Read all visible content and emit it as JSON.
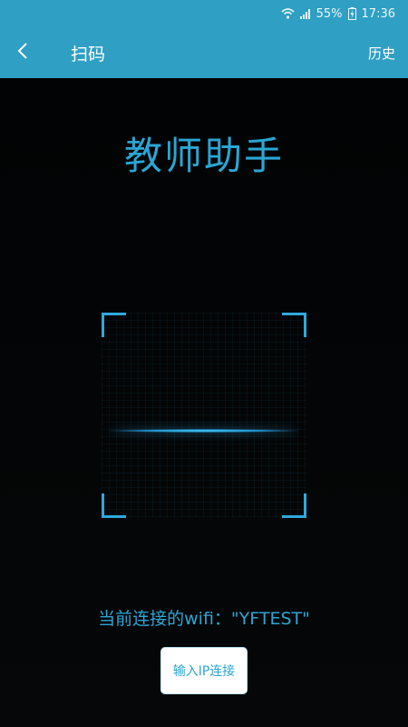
{
  "status_bar": {
    "battery": "55%",
    "time": "17:36",
    "icons": [
      "wifi-icon",
      "signal-icon",
      "battery-charging-icon"
    ]
  },
  "app_bar": {
    "back_icon": "chevron-left-icon",
    "title": "扫码",
    "history_label": "历史"
  },
  "main": {
    "app_name": "教师助手",
    "wifi_text": "当前连接的wifi：\"YFTEST\"",
    "ip_button_label": "输入IP连接"
  },
  "colors": {
    "accent": "#2aa6d4",
    "app_bar_bg": "#2f9fc4",
    "background": "#030506"
  }
}
